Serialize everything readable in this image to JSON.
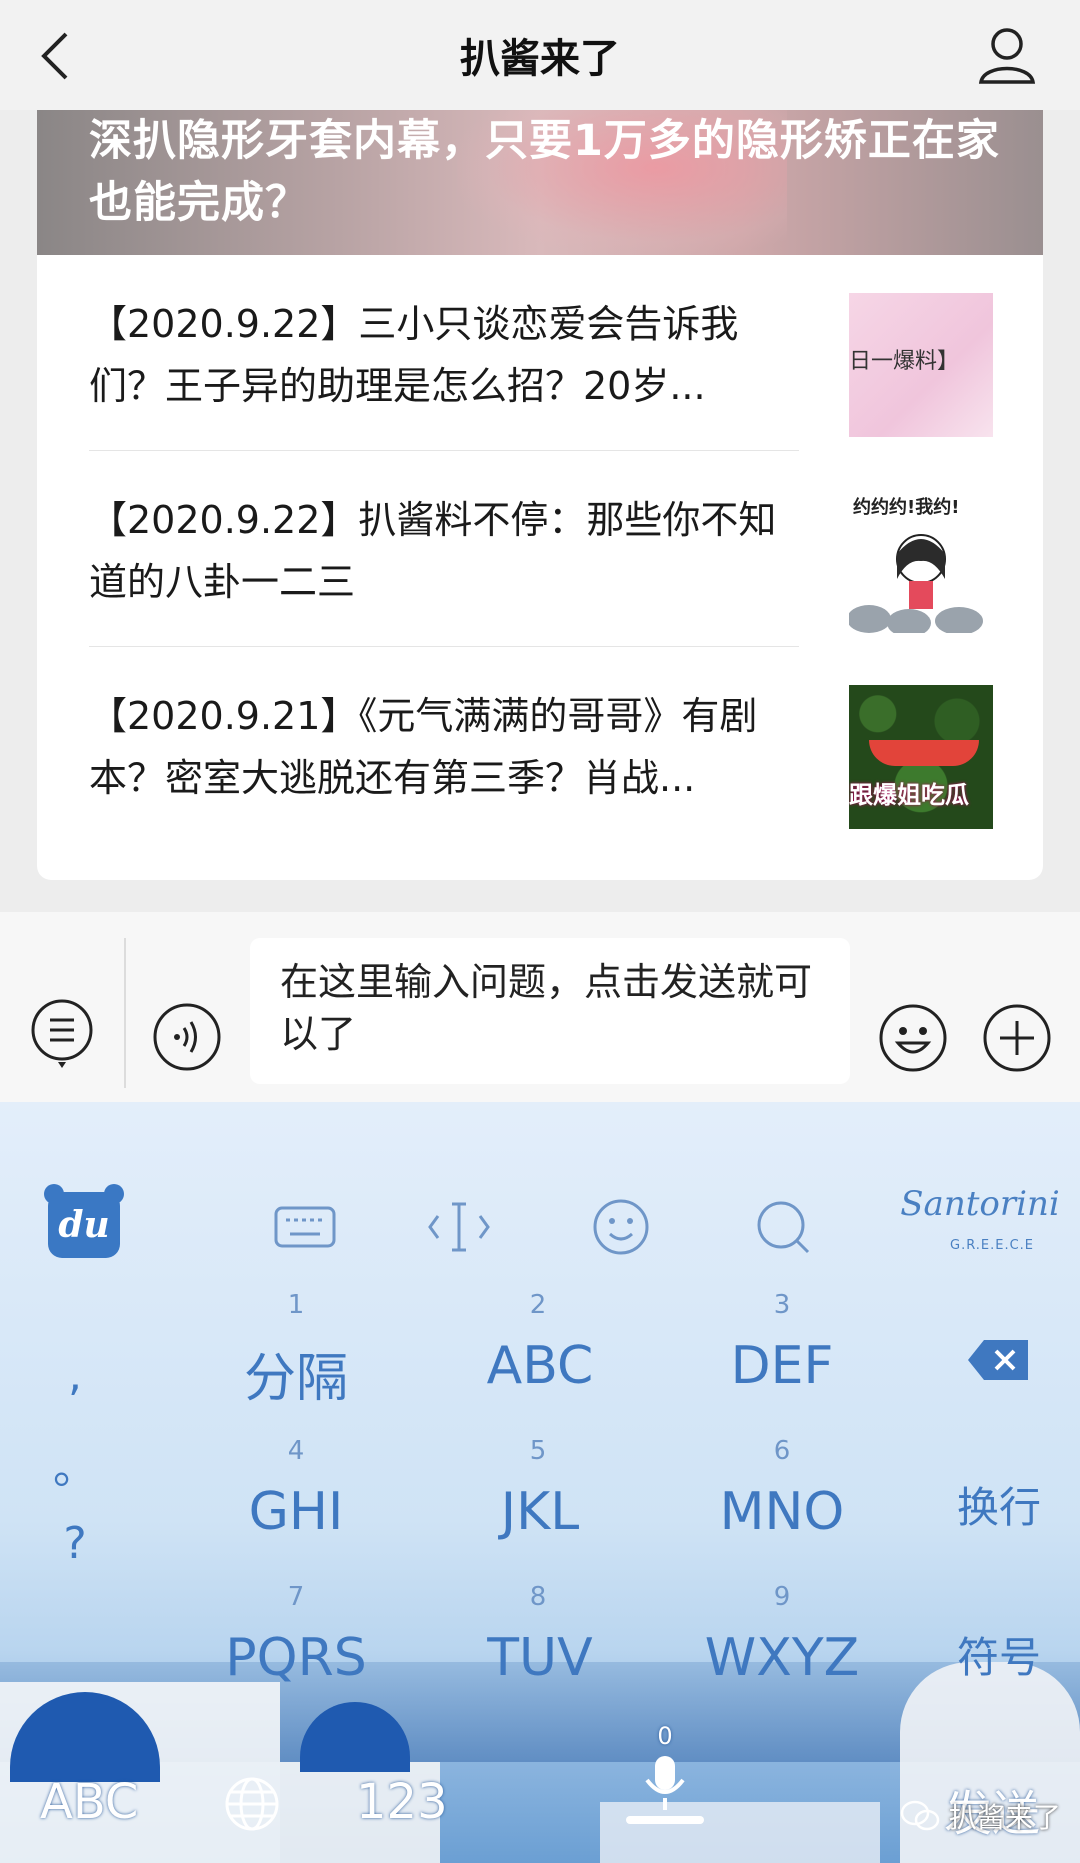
{
  "nav": {
    "title": "扒酱来了"
  },
  "hero": {
    "title": "深扒隐形牙套内幕，只要1万多的隐形矫正在家也能完成？"
  },
  "articles": [
    {
      "title": "【2020.9.22】三小只谈恋爱会告诉我们？王子异的助理是怎么招？20岁...",
      "thumb_text": "日一爆料】"
    },
    {
      "title": "【2020.9.22】扒酱料不停：那些你不知道的八卦一二三",
      "thumb_text": "约约约!我约!"
    },
    {
      "title": "【2020.9.21】《元气满满的哥哥》有剧本？密室大逃脱还有第三季？肖战...",
      "thumb_text": "跟爆姐吃瓜"
    }
  ],
  "input": {
    "placeholder": "在这里输入问题，点击发送就可以了"
  },
  "keyboard": {
    "logo": "du",
    "theme_text": "Santorini",
    "theme_sub": "G.R.E.E.C.E",
    "punct": [
      ",",
      "。",
      "?"
    ],
    "rows": [
      [
        {
          "num": "1",
          "label": "分隔"
        },
        {
          "num": "2",
          "label": "ABC"
        },
        {
          "num": "3",
          "label": "DEF"
        }
      ],
      [
        {
          "num": "4",
          "label": "GHI"
        },
        {
          "num": "5",
          "label": "JKL"
        },
        {
          "num": "6",
          "label": "MNO"
        }
      ],
      [
        {
          "num": "7",
          "label": "PQRS"
        },
        {
          "num": "8",
          "label": "TUV"
        },
        {
          "num": "9",
          "label": "WXYZ"
        }
      ]
    ],
    "enter": "换行",
    "symbols": "符号",
    "abc": "ABC",
    "num_mode": "123",
    "space_num": "0",
    "send": "发送"
  },
  "watermark": "扒酱来了",
  "colors": {
    "key_text": "#3f78c0",
    "nav_bg": "#f2f2f2"
  }
}
